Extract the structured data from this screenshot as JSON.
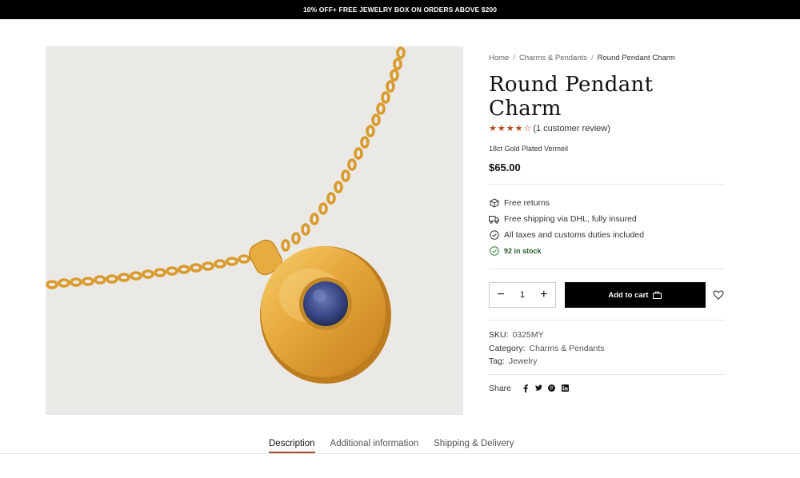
{
  "promo": {
    "text": "10% OFF+ FREE JEWELRY BOX ON ORDERS ABOVE $200"
  },
  "breadcrumb": {
    "items": [
      "Home",
      "Charms & Pendants",
      "Round Pendant Charm"
    ],
    "separator": "/"
  },
  "product": {
    "title": "Round Pendant Charm",
    "stars": "★★★★☆",
    "rating_value": 4,
    "rating_max": 5,
    "review_text": "(1 customer review)",
    "material": "18ct Gold Plated Vermeil",
    "price": "$65.00",
    "image_icon": "gold-pendant-necklace-image"
  },
  "features": [
    {
      "icon": "box-icon",
      "text": "Free returns"
    },
    {
      "icon": "truck-icon",
      "text": "Free shipping via DHL, fully insured"
    },
    {
      "icon": "check-circle-icon",
      "text": "All taxes and customs duties included"
    },
    {
      "icon": "check-circle-icon",
      "text": "92 in stock"
    }
  ],
  "purchase": {
    "quantity": "1",
    "minus": "−",
    "plus": "+",
    "add_to_cart": "Add to cart"
  },
  "meta": {
    "sku_label": "SKU:",
    "sku": "0325MY",
    "category_label": "Category:",
    "category": "Charms & Pendants",
    "tag_label": "Tag:",
    "tag": "Jewelry"
  },
  "share": {
    "label": "Share",
    "icons": [
      "facebook-icon",
      "twitter-icon",
      "pinterest-icon",
      "linkedin-icon"
    ]
  },
  "tabs": [
    {
      "label": "Description",
      "active": true
    },
    {
      "label": "Additional information",
      "active": false
    },
    {
      "label": "Shipping & Delivery",
      "active": false
    }
  ],
  "colors": {
    "accent": "#a64b2a",
    "stars": "#b34a1b",
    "stock": "#2e5d2e",
    "gold": "#e0a43a",
    "stone": "#3c4a8a",
    "image_bg": "#ebe9e6"
  }
}
